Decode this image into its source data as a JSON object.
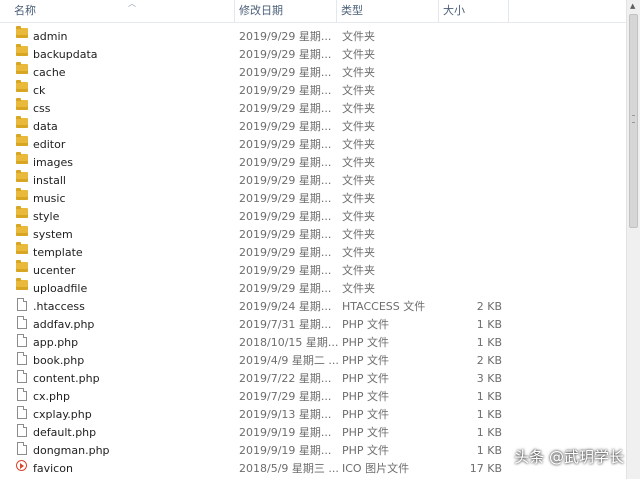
{
  "columns": {
    "name": "名称",
    "date": "修改日期",
    "type": "类型",
    "size": "大小"
  },
  "files": [
    {
      "name": "admin",
      "date": "2019/9/29 星期...",
      "type": "文件夹",
      "size": "",
      "icon": "folder-icon"
    },
    {
      "name": "backupdata",
      "date": "2019/9/29 星期...",
      "type": "文件夹",
      "size": "",
      "icon": "folder-icon"
    },
    {
      "name": "cache",
      "date": "2019/9/29 星期...",
      "type": "文件夹",
      "size": "",
      "icon": "folder-icon"
    },
    {
      "name": "ck",
      "date": "2019/9/29 星期...",
      "type": "文件夹",
      "size": "",
      "icon": "folder-icon"
    },
    {
      "name": "css",
      "date": "2019/9/29 星期...",
      "type": "文件夹",
      "size": "",
      "icon": "folder-icon"
    },
    {
      "name": "data",
      "date": "2019/9/29 星期...",
      "type": "文件夹",
      "size": "",
      "icon": "folder-icon"
    },
    {
      "name": "editor",
      "date": "2019/9/29 星期...",
      "type": "文件夹",
      "size": "",
      "icon": "folder-icon"
    },
    {
      "name": "images",
      "date": "2019/9/29 星期...",
      "type": "文件夹",
      "size": "",
      "icon": "folder-icon"
    },
    {
      "name": "install",
      "date": "2019/9/29 星期...",
      "type": "文件夹",
      "size": "",
      "icon": "folder-icon"
    },
    {
      "name": "music",
      "date": "2019/9/29 星期...",
      "type": "文件夹",
      "size": "",
      "icon": "folder-icon"
    },
    {
      "name": "style",
      "date": "2019/9/29 星期...",
      "type": "文件夹",
      "size": "",
      "icon": "folder-icon"
    },
    {
      "name": "system",
      "date": "2019/9/29 星期...",
      "type": "文件夹",
      "size": "",
      "icon": "folder-icon"
    },
    {
      "name": "template",
      "date": "2019/9/29 星期...",
      "type": "文件夹",
      "size": "",
      "icon": "folder-icon"
    },
    {
      "name": "ucenter",
      "date": "2019/9/29 星期...",
      "type": "文件夹",
      "size": "",
      "icon": "folder-icon"
    },
    {
      "name": "uploadfile",
      "date": "2019/9/29 星期...",
      "type": "文件夹",
      "size": "",
      "icon": "folder-icon"
    },
    {
      "name": ".htaccess",
      "date": "2019/9/24 星期...",
      "type": "HTACCESS 文件",
      "size": "2 KB",
      "icon": "file-icon"
    },
    {
      "name": "addfav.php",
      "date": "2019/7/31 星期...",
      "type": "PHP 文件",
      "size": "1 KB",
      "icon": "file-icon"
    },
    {
      "name": "app.php",
      "date": "2018/10/15 星期...",
      "type": "PHP 文件",
      "size": "1 KB",
      "icon": "file-icon"
    },
    {
      "name": "book.php",
      "date": "2019/4/9 星期二 ...",
      "type": "PHP 文件",
      "size": "2 KB",
      "icon": "file-icon"
    },
    {
      "name": "content.php",
      "date": "2019/7/22 星期...",
      "type": "PHP 文件",
      "size": "3 KB",
      "icon": "file-icon"
    },
    {
      "name": "cx.php",
      "date": "2019/7/29 星期...",
      "type": "PHP 文件",
      "size": "1 KB",
      "icon": "file-icon"
    },
    {
      "name": "cxplay.php",
      "date": "2019/9/13 星期...",
      "type": "PHP 文件",
      "size": "1 KB",
      "icon": "file-icon"
    },
    {
      "name": "default.php",
      "date": "2019/9/19 星期...",
      "type": "PHP 文件",
      "size": "1 KB",
      "icon": "file-icon"
    },
    {
      "name": "dongman.php",
      "date": "2019/9/19 星期...",
      "type": "PHP 文件",
      "size": "1 KB",
      "icon": "file-icon"
    },
    {
      "name": "favicon",
      "date": "2018/5/9 星期三 ...",
      "type": "ICO 图片文件",
      "size": "17 KB",
      "icon": "ico-image-icon"
    }
  ],
  "watermark": "头条 @武玥学长"
}
